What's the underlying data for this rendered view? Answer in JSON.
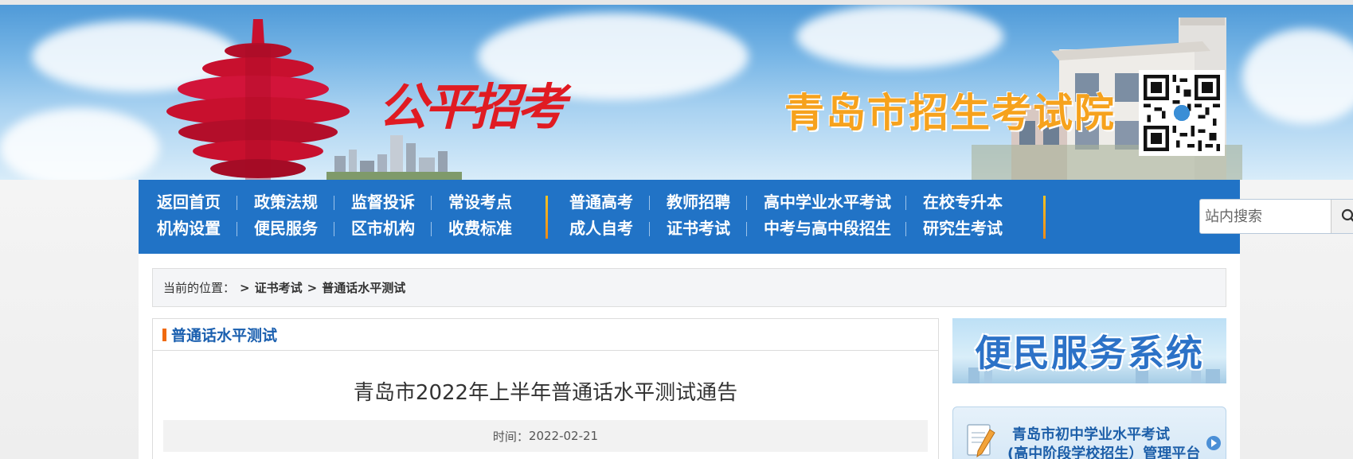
{
  "banner": {
    "slogan": "公平招考",
    "site_title": "青岛市招生考试院"
  },
  "nav": {
    "group1": [
      [
        "返回首页",
        "机构设置"
      ],
      [
        "政策法规",
        "便民服务"
      ],
      [
        "监督投诉",
        "区市机构"
      ],
      [
        "常设考点",
        "收费标准"
      ]
    ],
    "group2": [
      [
        "普通高考",
        "成人自考"
      ],
      [
        "教师招聘",
        "证书考试"
      ],
      [
        "高中学业水平考试",
        "中考与高中段招生"
      ],
      [
        "在校专升本",
        "研究生考试"
      ]
    ],
    "search_placeholder": "站内搜索"
  },
  "breadcrumb": {
    "label": "当前的位置：",
    "items": [
      "证书考试",
      "普通话水平测试"
    ],
    "separator": ">"
  },
  "article": {
    "section": "普通话水平测试",
    "title": "青岛市2022年上半年普通话水平测试通告",
    "time_label": "时间：",
    "date": "2022-02-21"
  },
  "sidebar": {
    "banner_text": "便民服务系统",
    "link_line1": "青岛市初中学业水平考试",
    "link_line2": "(高中阶段学校招生）管理平台"
  },
  "colors": {
    "nav_bg": "#2173c6",
    "accent_orange": "#f06a0f",
    "title_orange": "#f6a21d",
    "slogan_red": "#e01b22"
  }
}
